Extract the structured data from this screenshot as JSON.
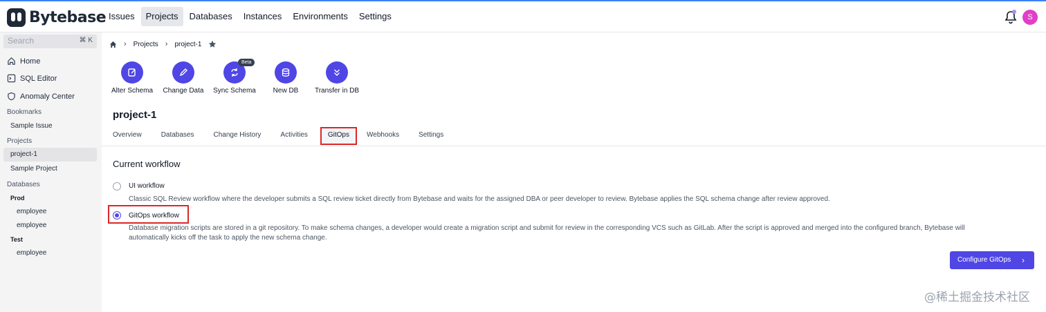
{
  "app": {
    "name": "Bytebase"
  },
  "topnav": {
    "items": [
      "Issues",
      "Projects",
      "Databases",
      "Instances",
      "Environments",
      "Settings"
    ],
    "active": "Projects",
    "avatar_initial": "S"
  },
  "sidebar": {
    "search_placeholder": "Search",
    "search_shortcut": "⌘ K",
    "home": "Home",
    "sql_editor": "SQL Editor",
    "anomaly_center": "Anomaly Center",
    "bookmarks_heading": "Bookmarks",
    "bookmarks": [
      "Sample Issue"
    ],
    "projects_heading": "Projects",
    "projects": [
      "project-1",
      "Sample Project"
    ],
    "databases_heading": "Databases",
    "env_prod": "Prod",
    "prod_dbs": [
      "employee",
      "employee"
    ],
    "env_test": "Test",
    "test_dbs": [
      "employee"
    ]
  },
  "breadcrumb": {
    "root": "Projects",
    "current": "project-1"
  },
  "quick_actions": {
    "items": [
      "Alter Schema",
      "Change Data",
      "Sync Schema",
      "New DB",
      "Transfer in DB"
    ],
    "beta_badge": "Beta"
  },
  "project": {
    "title": "project-1",
    "tabs": [
      "Overview",
      "Databases",
      "Change History",
      "Activities",
      "GitOps",
      "Webhooks",
      "Settings"
    ],
    "active_tab": "GitOps"
  },
  "workflow": {
    "section_title": "Current workflow",
    "ui_title": "UI workflow",
    "ui_desc": "Classic SQL Review workflow where the developer submits a SQL review ticket directly from Bytebase and waits for the assigned DBA or peer developer to review. Bytebase applies the SQL schema change after review approved.",
    "gitops_title": "GitOps workflow",
    "gitops_desc_1": "Database migration scripts are stored in a git repository. To make schema changes, a developer would create a migration script and submit for review in the corresponding VCS such as GitLab. After the script is approved and merged into the configured branch, Bytebase will",
    "gitops_desc_2": "automatically kicks off the task to apply the new schema change.",
    "selected": "gitops",
    "configure_button": "Configure GitOps"
  },
  "watermark": "@稀土掘金技术社区",
  "colors": {
    "accent": "#4f46e5",
    "highlight": "#dc2626"
  }
}
